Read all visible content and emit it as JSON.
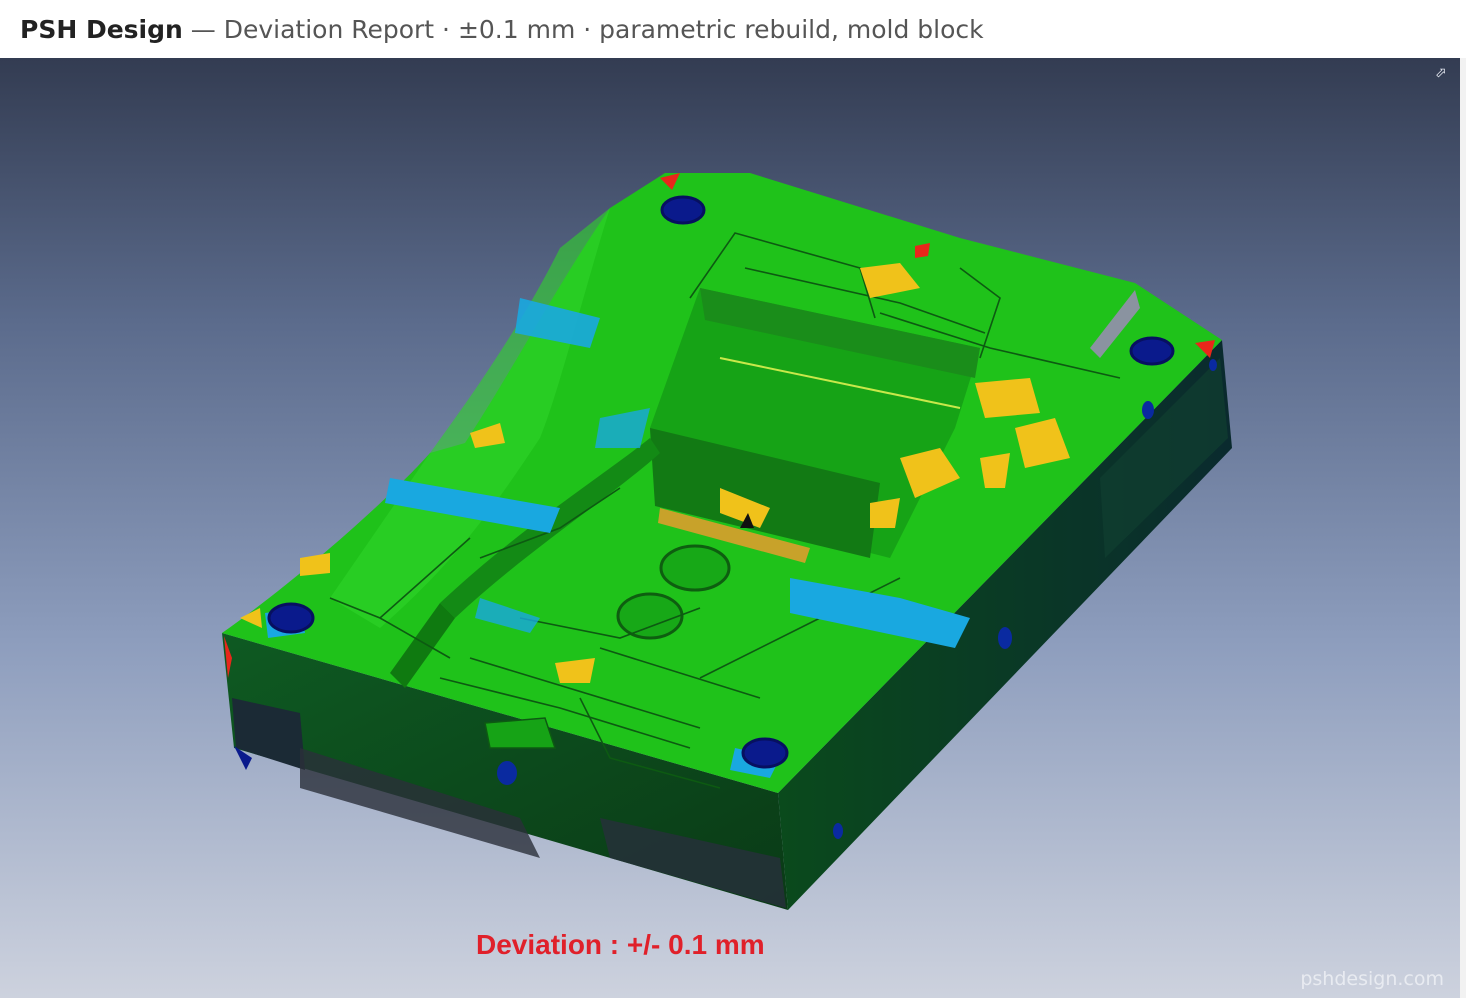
{
  "header": {
    "brand": "PSH Design",
    "subtitle": " — Deviation Report  ·  ±0.1 mm  ·  parametric rebuild, mold block"
  },
  "viewport": {
    "expand_glyph": "⬀",
    "expand_icon": "expand-icon",
    "caption": "Deviation : +/- 0.1 mm",
    "watermark": "pshdesign.com"
  },
  "colors": {
    "caption": "#e0202a",
    "deviation_ok": "#1fc21a",
    "deviation_negative": "#19a8e0",
    "deviation_positive": "#f0c21a",
    "deviation_high": "#e8271b",
    "deviation_low": "#0a1a8c",
    "side_face": "#0c4d1c"
  }
}
